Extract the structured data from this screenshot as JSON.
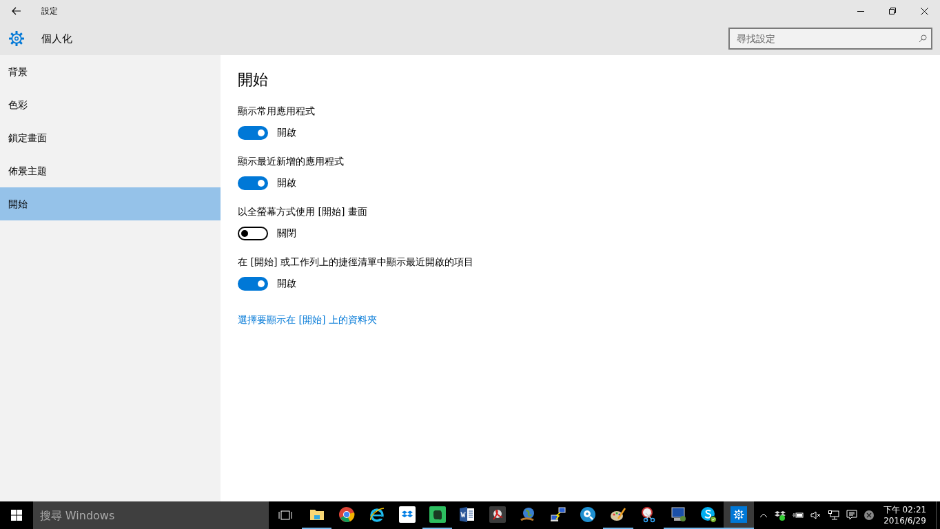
{
  "window": {
    "title": "設定"
  },
  "header": {
    "title": "個人化",
    "search": {
      "placeholder": "尋找設定"
    }
  },
  "sidebar": {
    "items": [
      {
        "label": "背景",
        "selected": false
      },
      {
        "label": "色彩",
        "selected": false
      },
      {
        "label": "鎖定畫面",
        "selected": false
      },
      {
        "label": "佈景主題",
        "selected": false
      },
      {
        "label": "開始",
        "selected": true
      }
    ]
  },
  "content": {
    "heading": "開始",
    "settings": [
      {
        "label": "顯示常用應用程式",
        "on": true,
        "state": "開啟"
      },
      {
        "label": "顯示最近新增的應用程式",
        "on": true,
        "state": "開啟"
      },
      {
        "label": "以全螢幕方式使用 [開始] 畫面",
        "on": false,
        "state": "關閉"
      },
      {
        "label": "在 [開始] 或工作列上的捷徑清單中顯示最近開啟的項目",
        "on": true,
        "state": "開啟"
      }
    ],
    "link": "選擇要顯示在 [開始] 上的資料夾"
  },
  "taskbar": {
    "search": {
      "placeholder": "搜尋 Windows"
    },
    "apps": [
      {
        "kind": "folder",
        "running": true,
        "active": false
      },
      {
        "kind": "chrome",
        "running": false,
        "active": false
      },
      {
        "kind": "ie",
        "running": false,
        "active": false
      },
      {
        "kind": "dropbox",
        "running": false,
        "active": false
      },
      {
        "kind": "evernote",
        "running": true,
        "active": false
      },
      {
        "kind": "word",
        "running": false,
        "active": false
      },
      {
        "kind": "acrobat",
        "running": false,
        "active": false
      },
      {
        "kind": "globe",
        "running": false,
        "active": false
      },
      {
        "kind": "network",
        "running": false,
        "active": false
      },
      {
        "kind": "quicktime",
        "running": false,
        "active": false
      },
      {
        "kind": "paint",
        "running": true,
        "active": false
      },
      {
        "kind": "snip",
        "running": false,
        "active": false
      },
      {
        "kind": "remote",
        "running": true,
        "active": false
      },
      {
        "kind": "skype",
        "running": true,
        "active": false
      },
      {
        "kind": "settings",
        "running": true,
        "active": true
      }
    ],
    "clock": {
      "time": "下午 02:21",
      "date": "2016/6/29"
    }
  }
}
